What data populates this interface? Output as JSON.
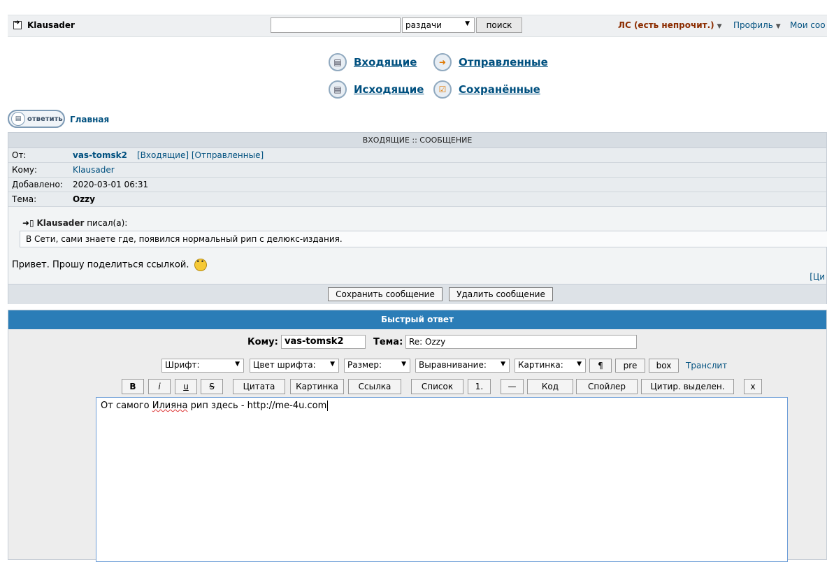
{
  "topbar": {
    "username": "Klausader",
    "search_placeholder": "",
    "search_scope": "раздачи",
    "search_button": "поиск",
    "pm_link": "ЛС (есть непрочит.)",
    "profile_link": "Профиль",
    "mine_link": "Мои coo"
  },
  "folders": {
    "inbox": "Входящие",
    "sent": "Отправленные",
    "outbox": "Исходящие",
    "saved": "Сохранённые"
  },
  "nav": {
    "reply_button": "ответить",
    "home_link": "Главная"
  },
  "message": {
    "caption": "ВХОДЯЩИЕ :: СООБЩЕНИЕ",
    "from_label": "От:",
    "from_value": "vas-tomsk2",
    "from_links": "[Входящие] [Отправленные]",
    "to_label": "Кому:",
    "to_value": "Klausader",
    "date_label": "Добавлено:",
    "date_value": "2020-03-01 06:31",
    "subject_label": "Тема:",
    "subject_value": "Ozzy",
    "quote_author": "Klausader",
    "quote_wrote": "писал(а):",
    "quote_text": "В Сети, сами знаете где, появился нормальный рип с делюкс-издания.",
    "body": "Привет. Прошу поделиться ссылкой.",
    "cut_link": "[Ци",
    "save_button": "Сохранить сообщение",
    "delete_button": "Удалить сообщение"
  },
  "quick_reply": {
    "caption": "Быстрый ответ",
    "to_label": "Кому:",
    "to_value": "vas-tomsk2",
    "subject_label": "Тема:",
    "subject_value": "Re: Ozzy",
    "selects": {
      "font": "Шрифт:",
      "color": "Цвет шрифта:",
      "size": "Размер:",
      "align": "Выравнивание:",
      "image": "Картинка:"
    },
    "btn_para": "¶",
    "btn_pre": "pre",
    "btn_box": "box",
    "translit": "Транслит",
    "buttons": {
      "bold": "B",
      "italic": "i",
      "underline": "u",
      "strike": "S",
      "quote": "Цитата",
      "img": "Картинка",
      "link": "Ссылка",
      "list": "Список",
      "list_num": "1.",
      "hr": "—",
      "code": "Код",
      "spoiler": "Спойлер",
      "quote_sel": "Цитир. выделен.",
      "close": "x"
    },
    "editor_before": "От самого ",
    "editor_word": "Илияна",
    "editor_after": " рип здесь - http://me-4u.com"
  }
}
